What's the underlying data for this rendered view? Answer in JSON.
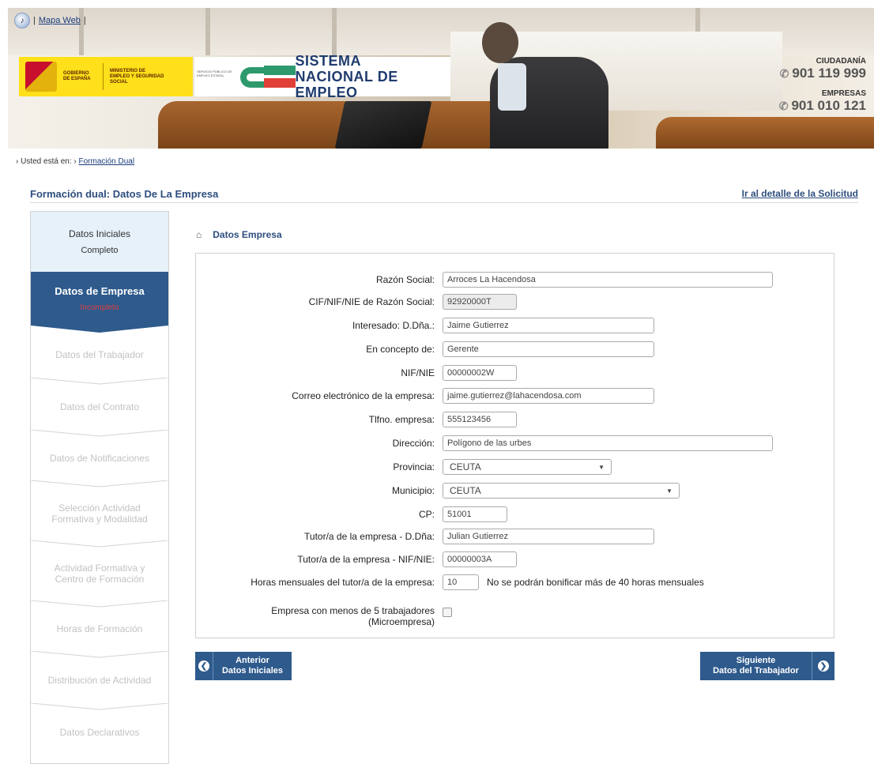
{
  "header": {
    "sitemap_link": "Mapa Web",
    "gov_text": "GOBIERNO DE ESPAÑA",
    "ministry_text": "MINISTERIO DE EMPLEO Y SEGURIDAD SOCIAL",
    "sepe_text": "SERVICIO PÚBLICO DE EMPLEO ESTATAL",
    "sne_line1": "SISTEMA",
    "sne_line2": "NACIONAL DE EMPLEO",
    "citizen_label": "CIUDADANÍA",
    "citizen_phone": "901 119 999",
    "company_label": "EMPRESAS",
    "company_phone": "901 010 121"
  },
  "breadcrumb": {
    "prefix": "Usted está en:",
    "link": "Formación Dual"
  },
  "page": {
    "title": "Formación dual: Datos De La Empresa",
    "detail_link": "Ir al detalle de la Solicitud"
  },
  "sidebar": {
    "steps": [
      {
        "label": "Datos Iniciales",
        "status": "Completo"
      },
      {
        "label": "Datos de Empresa",
        "status": "Incompleto"
      },
      {
        "label": "Datos del Trabajador"
      },
      {
        "label": "Datos del Contrato"
      },
      {
        "label": "Datos de Notificaciones"
      },
      {
        "label": "Selección Actividad Formativa y Modalidad"
      },
      {
        "label": "Actividad Formativa y Centro de Formación"
      },
      {
        "label": "Horas de Formación"
      },
      {
        "label": "Distribución de Actividad"
      },
      {
        "label": "Datos Declarativos"
      }
    ]
  },
  "panel": {
    "title": "Datos Empresa"
  },
  "form": {
    "razon_social": {
      "label": "Razón Social:",
      "value": "Arroces La Hacendosa"
    },
    "cif": {
      "label": "CIF/NIF/NIE de Razón Social:",
      "value": "92920000T"
    },
    "interesado": {
      "label": "Interesado: D.Dña.:",
      "value": "Jaime Gutierrez"
    },
    "concepto": {
      "label": "En concepto de:",
      "value": "Gerente"
    },
    "nif": {
      "label": "NIF/NIE",
      "value": "00000002W"
    },
    "correo": {
      "label": "Correo electrónico de la empresa:",
      "value": "jaime.gutierrez@lahacendosa.com"
    },
    "telefono": {
      "label": "Tlfno. empresa:",
      "value": "555123456"
    },
    "direccion": {
      "label": "Dirección:",
      "value": "Polígono de las urbes"
    },
    "provincia": {
      "label": "Provincia:",
      "value": "CEUTA"
    },
    "municipio": {
      "label": "Municipio:",
      "value": "CEUTA"
    },
    "cp": {
      "label": "CP:",
      "value": "51001"
    },
    "tutor_nombre": {
      "label": "Tutor/a de la empresa - D.Dña:",
      "value": "Julian Gutierrez"
    },
    "tutor_nif": {
      "label": "Tutor/a de la empresa - NIF/NIE:",
      "value": "00000003A"
    },
    "horas": {
      "label": "Horas mensuales del tutor/a de la empresa:",
      "value": "10",
      "note": "No se podrán bonificar más de 40 horas mensuales"
    },
    "micro": {
      "label_line1": "Empresa con menos de 5 trabajadores",
      "label_line2": "(Microempresa)",
      "checked": false
    }
  },
  "nav": {
    "prev_line1": "Anterior",
    "prev_line2": "Datos Iniciales",
    "next_line1": "Siguiente",
    "next_line2": "Datos del Trabajador"
  },
  "colors": {
    "accent": "#2e5a8c",
    "title": "#2e4e7e",
    "incomplete": "#e04040"
  }
}
